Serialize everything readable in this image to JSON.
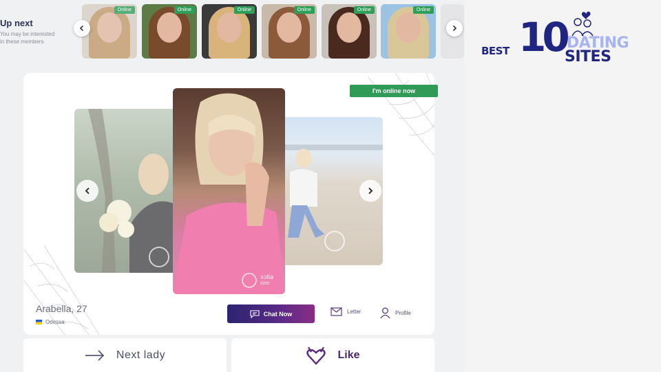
{
  "upnext": {
    "title": "Up next",
    "subtitle_line1": "You may be interested",
    "subtitle_line2": "in these members",
    "prev_icon": "chevron-left-icon",
    "next_icon": "chevron-right-icon",
    "thumbnails": [
      {
        "status": "Online",
        "hair": "#c29a6b",
        "bg": "#d8cfc6"
      },
      {
        "status": "Online",
        "hair": "#7a4a2c",
        "bg": "#5e7a47"
      },
      {
        "status": "Online",
        "hair": "#d8b47a",
        "bg": "#3a3a3a"
      },
      {
        "status": "Online",
        "hair": "#8a5a3a",
        "bg": "#c9b9a8"
      },
      {
        "status": "Online",
        "hair": "#4a2a1e",
        "bg": "#c9c2bb"
      },
      {
        "status": "Online",
        "hair": "#d9c79a",
        "bg": "#9cc3e1"
      }
    ]
  },
  "profile": {
    "online_banner": "I'm online now",
    "name_age": "Arabella, 27",
    "city": "Odessa",
    "chat_button": "Chat Now",
    "letter_link": "Letter",
    "profile_link": "Profile",
    "watermark_line1": "sofia",
    "watermark_line2": "date"
  },
  "actions": {
    "next_label": "Next lady",
    "like_label": "Like"
  },
  "logo": {
    "best": "BEST",
    "ten": "10",
    "dating": "DATING",
    "sites": "SITES"
  },
  "colors": {
    "online_green": "#2f9b56",
    "chat_gradient_start": "#2b2470",
    "chat_gradient_end": "#8a2e84",
    "brand_navy": "#1f2580",
    "brand_lavender": "#a8b4ee"
  }
}
